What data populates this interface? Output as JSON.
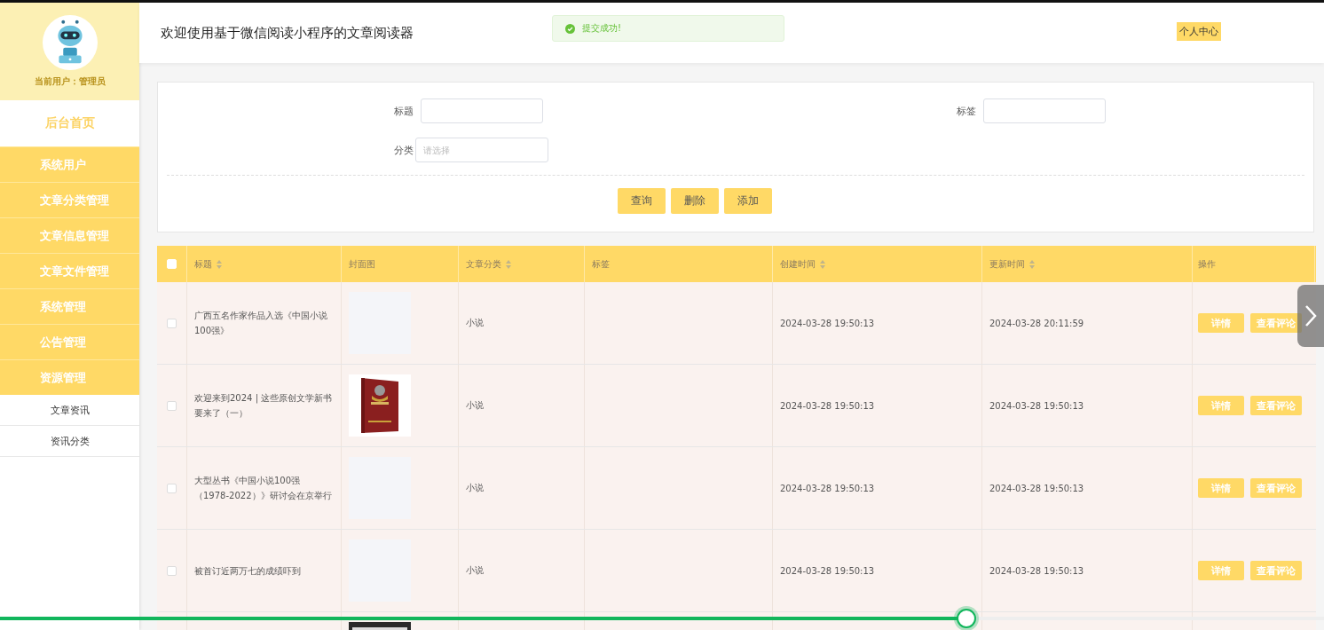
{
  "sidebar": {
    "user_label": "当前用户：管理员",
    "home": "后台首页",
    "items": [
      {
        "label": "系统用户",
        "kind": "group"
      },
      {
        "label": "文章分类管理",
        "kind": "group"
      },
      {
        "label": "文章信息管理",
        "kind": "group"
      },
      {
        "label": "文章文件管理",
        "kind": "group"
      },
      {
        "label": "系统管理",
        "kind": "group"
      },
      {
        "label": "公告管理",
        "kind": "group"
      },
      {
        "label": "资源管理",
        "kind": "group"
      },
      {
        "label": "文章资讯",
        "kind": "sub"
      },
      {
        "label": "资讯分类",
        "kind": "sub"
      }
    ]
  },
  "header": {
    "title": "欢迎使用基于微信阅读小程序的文章阅读器",
    "toast": "提交成功!",
    "user_center": "个人中心"
  },
  "filters": {
    "title_label": "标题",
    "tag_label": "标签",
    "category_label": "分类",
    "category_placeholder": "请选择",
    "buttons": [
      "查询",
      "删除",
      "添加"
    ]
  },
  "table": {
    "all_checked": false,
    "columns": [
      {
        "label": "标题",
        "sortable": true
      },
      {
        "label": "封面图",
        "sortable": false
      },
      {
        "label": "文章分类",
        "sortable": true
      },
      {
        "label": "标签",
        "sortable": false
      },
      {
        "label": "创建时间",
        "sortable": true
      },
      {
        "label": "更新时间",
        "sortable": true
      },
      {
        "label": "操作",
        "sortable": false
      }
    ],
    "rows": [
      {
        "checked": false,
        "title": "广西五名作家作品入选《中国小说100强》",
        "cover": {
          "kind": "empty"
        },
        "category": "小说",
        "created": "2024-03-28 19:50:13",
        "updated": "2024-03-28 20:11:59",
        "actions": [
          "详情",
          "查看评论"
        ]
      },
      {
        "checked": false,
        "title": "欢迎来到2024 | 这些原创文学新书要来了（一）",
        "cover": {
          "kind": "picture"
        },
        "category": "小说",
        "created": "2024-03-28 19:50:13",
        "updated": "2024-03-28 19:50:13",
        "actions": [
          "详情",
          "查看评论"
        ]
      },
      {
        "checked": false,
        "title": "大型丛书《中国小说100强（1978-2022）》研讨会在京举行",
        "cover": {
          "kind": "empty"
        },
        "category": "小说",
        "created": "2024-03-28 19:50:13",
        "updated": "2024-03-28 19:50:13",
        "actions": [
          "详情",
          "查看评论"
        ]
      },
      {
        "checked": false,
        "title": "被首订近两万七的成绩吓到",
        "cover": {
          "kind": "empty"
        },
        "category": "小说",
        "created": "2024-03-28 19:50:13",
        "updated": "2024-03-28 19:50:13",
        "actions": [
          "详情",
          "查看评论"
        ]
      },
      {
        "cover": {
          "kind": "picture"
        }
      }
    ]
  },
  "player": {
    "level": 0.73
  }
}
